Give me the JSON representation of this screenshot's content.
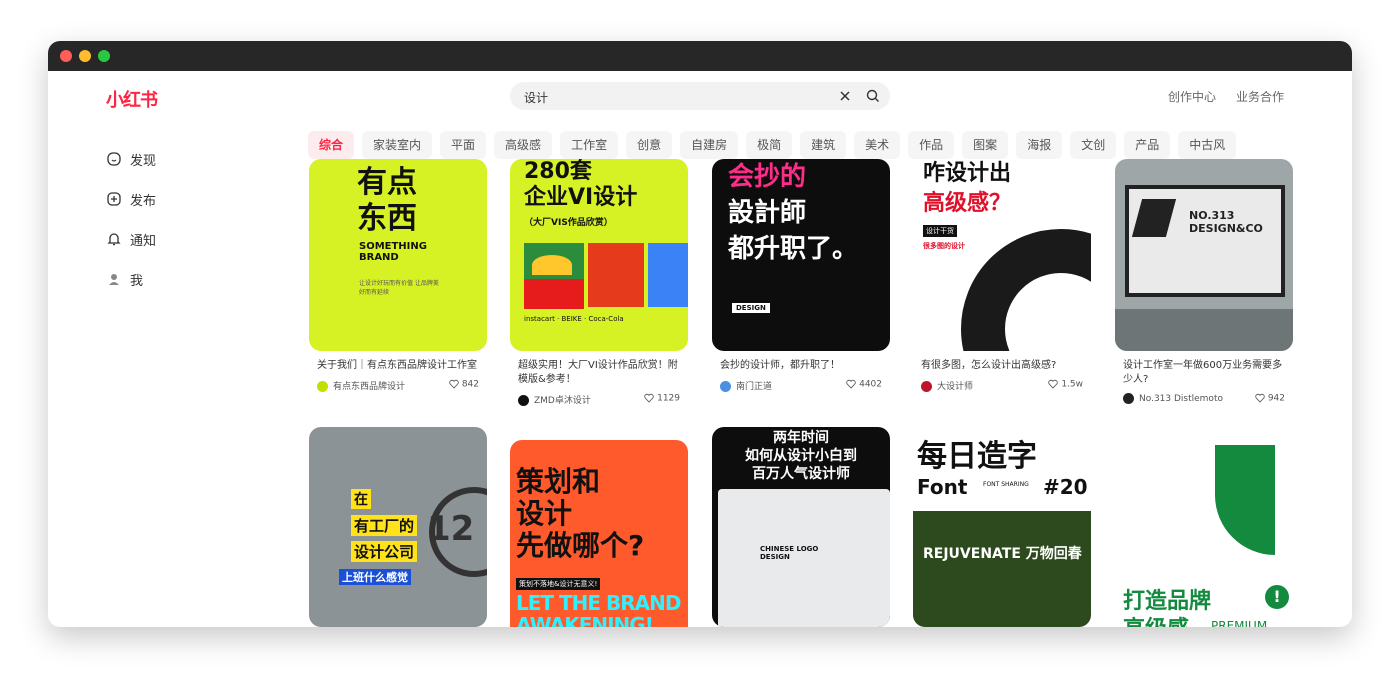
{
  "brand": {
    "logo": "小红书",
    "color": "#ff2442"
  },
  "search": {
    "value": "设计"
  },
  "top_nav": {
    "create": "创作中心",
    "business": "业务合作"
  },
  "sidebar": [
    {
      "label": "发现",
      "icon": "compass-icon"
    },
    {
      "label": "发布",
      "icon": "plus-square-icon"
    },
    {
      "label": "通知",
      "icon": "bell-icon"
    },
    {
      "label": "我",
      "icon": "avatar-icon"
    }
  ],
  "chips": [
    "综合",
    "家装室内",
    "平面",
    "高级感",
    "工作室",
    "创意",
    "自建房",
    "极简",
    "建筑",
    "美术",
    "作品",
    "图案",
    "海报",
    "文创",
    "产品",
    "中古风"
  ],
  "active_chip": "综合",
  "cards": [
    {
      "caption": "关于我们｜有点东西品牌设计工作室",
      "author": "有点东西品牌设计",
      "likes": "842",
      "thumb": {
        "lines": [
          "有点",
          "东西"
        ],
        "sub": "SOMETHING BRAND",
        "extra": "让设计好玩而有价值 让品牌美好而有延续"
      }
    },
    {
      "caption": "超级实用！大厂VI设计作品欣赏！附模版&参考！",
      "author": "ZMD卓沐设计",
      "likes": "1129",
      "thumb": {
        "lines": [
          "280套",
          "企业VI设计"
        ],
        "sub": "（大厂VIS作品欣赏）",
        "extra": "instacart · BEIKE · Coca-Cola"
      }
    },
    {
      "caption": "会抄的设计师，都升职了！",
      "author": "南门正道",
      "likes": "4402",
      "thumb": {
        "lines": [
          "会抄的",
          "設計師",
          "都升职了。"
        ],
        "sub": "DESIGN",
        "extra": ""
      }
    },
    {
      "caption": "有很多图，怎么设计出高级感?",
      "author": "大设计师",
      "likes": "1.5w",
      "thumb": {
        "lines": [
          "咋设计出",
          "高级感？"
        ],
        "sub": "设计干货",
        "extra": "很多图的设计"
      }
    },
    {
      "caption": "设计工作室一年做600万业务需要多少人?",
      "author": "No.313 Distlemoto",
      "likes": "942",
      "thumb": {
        "lines": [
          "NO.313",
          "DESIGN&CO"
        ],
        "sub": "",
        "extra": ""
      }
    }
  ],
  "cards_row2": [
    {
      "thumb": {
        "lines": [
          "在",
          "有工厂的",
          "设计公司",
          "上班什么感觉"
        ],
        "extra": "12"
      }
    },
    {
      "thumb": {
        "lines": [
          "策划和",
          "设计",
          "先做哪个?"
        ],
        "sub": "策划不落地&设计无意义!",
        "extra": "LET THE BRAND AWAKENING!"
      }
    },
    {
      "thumb": {
        "lines": [
          "两年时间",
          "如何从设计小白到",
          "百万人气设计师"
        ],
        "extra": "CHINESE LOGO DESIGN"
      }
    },
    {
      "thumb": {
        "lines": [
          "每日造字",
          "Font",
          "#20"
        ],
        "sub": "FONT SHARING",
        "extra": "REJUVENATE 万物回春"
      }
    },
    {
      "thumb": {
        "lines": [
          "打造品牌",
          "高级感"
        ],
        "extra": "PREMIUM"
      }
    }
  ]
}
